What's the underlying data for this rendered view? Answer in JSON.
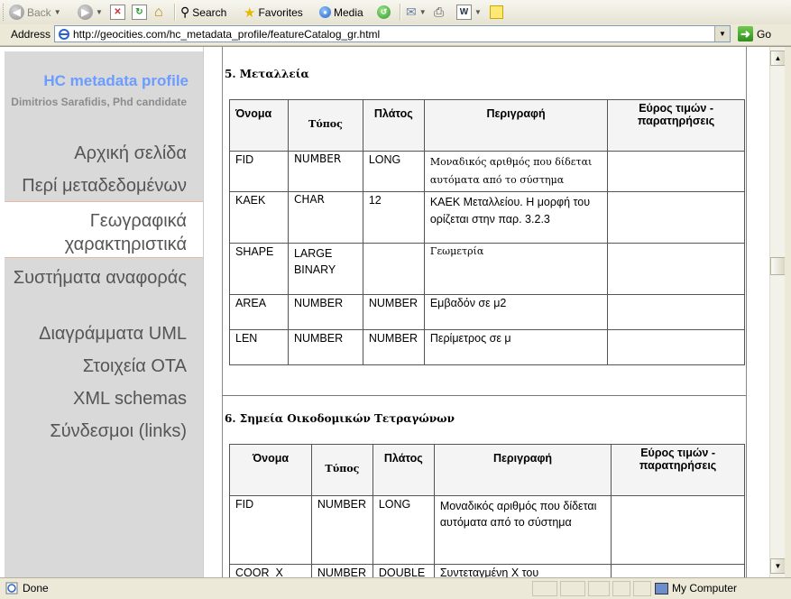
{
  "toolbar": {
    "back": "Back",
    "search": "Search",
    "favorites": "Favorites",
    "media": "Media"
  },
  "address": {
    "label": "Address",
    "url": "http://geocities.com/hc_metadata_profile/featureCatalog_gr.html",
    "go": "Go"
  },
  "sidebar": {
    "title": "HC metadata profile",
    "subtitle": "Dimitrios Sarafidis, Phd candidate",
    "items": [
      {
        "label": "Αρχική σελίδα"
      },
      {
        "label": "Περί μεταδεδομένων"
      },
      {
        "label": "Γεωγραφικά χαρακτηριστικά"
      },
      {
        "label": "Συστήματα αναφοράς"
      },
      {
        "label": "Διαγράμματα UML"
      },
      {
        "label": "Στοιχεία ΟΤΑ"
      },
      {
        "label": "XML schemas"
      },
      {
        "label": "Σύνδεσμοι (links)"
      }
    ]
  },
  "sections": [
    {
      "title": "5. Μεταλλεία",
      "headers": [
        "Όνομα",
        "Τύπος",
        "Πλάτος",
        "Περιγραφή",
        "Εύρος τιμών - παρατηρήσεις"
      ],
      "rows": [
        [
          "FID",
          "NUMBER",
          "LONG",
          "Μοναδικός αριθμός που δίδεται αυτόματα από το σύστημα",
          ""
        ],
        [
          "ΚΑΕΚ",
          "CHAR",
          "12",
          "ΚΑΕΚ Μεταλλείου. Η μορφή του ορίζεται στην παρ. 3.2.3",
          ""
        ],
        [
          "SHAPE",
          "LARGE BINARY",
          "",
          "Γεωμετρία",
          ""
        ],
        [
          "AREA",
          "NUMBER",
          "NUMBER",
          "Εμβαδόν σε μ2",
          ""
        ],
        [
          "LEN",
          "NUMBER",
          "NUMBER",
          "Περίμετρος σε μ",
          ""
        ]
      ]
    },
    {
      "title": "6. Σημεία Οικοδομικών Τετραγώνων",
      "headers": [
        "Όνομα",
        "Τύπος",
        "Πλάτος",
        "Περιγραφή",
        "Εύρος τιμών - παρατηρήσεις"
      ],
      "rows": [
        [
          "FID",
          "NUMBER",
          "LONG",
          "Μοναδικός αριθμός που δίδεται αυτόματα από το σύστημα",
          ""
        ],
        [
          "COOR_X",
          "NUMBER",
          "DOUBLE",
          "Συντεταγμένη Χ του",
          ""
        ]
      ]
    }
  ],
  "status": {
    "text": "Done",
    "zone": "My Computer"
  }
}
